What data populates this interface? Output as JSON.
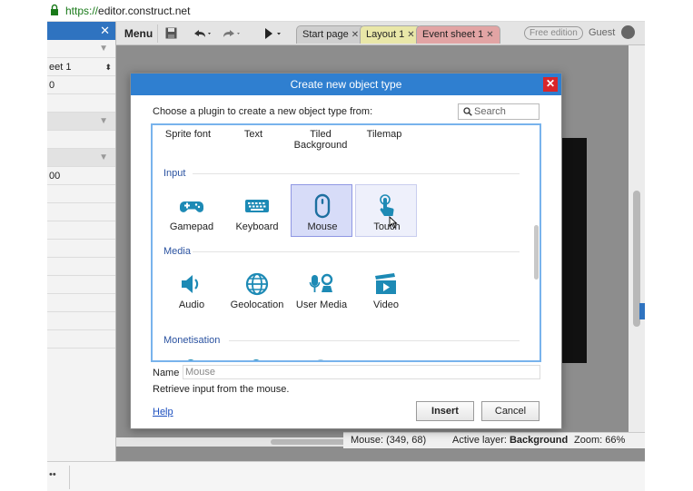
{
  "browser": {
    "url_scheme": "https://",
    "url_host": "editor.construct.net"
  },
  "left_panel": {
    "close": "✕",
    "rows": [
      "",
      "eet 1",
      "0",
      "",
      "",
      "",
      "",
      "00",
      "",
      "",
      "",
      "",
      ""
    ]
  },
  "toolbar": {
    "menu_label": "Menu",
    "free_badge": "Free edition",
    "guest_label": "Guest"
  },
  "tabs": [
    {
      "label": "Start page",
      "close": "✕"
    },
    {
      "label": "Layout 1",
      "close": "✕"
    },
    {
      "label": "Event sheet 1",
      "close": "✕"
    }
  ],
  "statusbar": {
    "mouse": "Mouse: (349, 68)",
    "layer_label": "Active layer:",
    "layer_value": "Background",
    "zoom": "Zoom: 66%"
  },
  "taskbar": {
    "dots": "••"
  },
  "dialog": {
    "title": "Create new object type",
    "close": "✕",
    "prompt": "Choose a plugin to create a new object type from:",
    "search_placeholder": "Search",
    "top_row": [
      "Sprite font",
      "Text",
      "Tiled Background",
      "Tilemap"
    ],
    "categories": {
      "input": "Input",
      "media": "Media",
      "monetisation": "Monetisation"
    },
    "input_plugins": [
      "Gamepad",
      "Keyboard",
      "Mouse",
      "Touch"
    ],
    "media_plugins": [
      "Audio",
      "Geolocation",
      "User Media",
      "Video"
    ],
    "selected_plugin": "Mouse",
    "name_label": "Name",
    "name_value": "Mouse",
    "description": "Retrieve input from the mouse.",
    "help_link": "Help",
    "insert_button": "Insert",
    "cancel_button": "Cancel"
  },
  "colors": {
    "accent_blue": "#2f7fd0",
    "icon_teal": "#1d8ab5",
    "close_red": "#d9262a",
    "selected_bg": "#d7dcf8"
  }
}
